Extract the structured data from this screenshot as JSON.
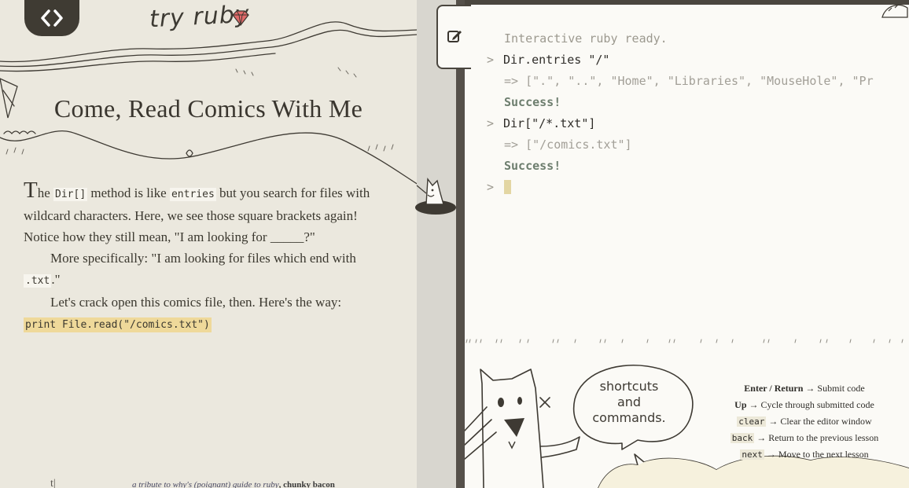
{
  "header": {
    "site_title": "try ruby",
    "logo_icon": "code-brackets-icon"
  },
  "lesson": {
    "title": "Come, Read Comics With Me",
    "p1_dropcap": "T",
    "p1_a": "he ",
    "p1_code1": "Dir[]",
    "p1_b": " method is like ",
    "p1_code2": "entries",
    "p1_c": " but you search for files with wildcard characters. Here, we see those square brackets again! Notice how they still mean, \"I am looking for _____?\"",
    "p2_a": "More specifically: \"I am looking for files which end with ",
    "p2_code": ".txt",
    "p2_b": ".\"",
    "p3": "Let's crack open this comics file, then. Here's the way:",
    "snippet": "print File.read(\"/comics.txt\")"
  },
  "footer": {
    "mark": "t|",
    "tribute_prefix": "a tribute to ",
    "tribute_link": "why's (poignant) guide to ruby",
    "tribute_suffix": ", chunky bacon"
  },
  "console": {
    "ready": "Interactive ruby ready.",
    "prompt_symbol": ">",
    "lines": [
      {
        "input": "Dir.entries \"/\"",
        "result": "=> [\".\", \"..\", \"Home\", \"Libraries\", \"MouseHole\", \"Pr",
        "status": "Success!"
      },
      {
        "input": "Dir[\"/*.txt\"]",
        "result": "=> [\"/comics.txt\"]",
        "status": "Success!"
      }
    ]
  },
  "illustration": {
    "speech_bubble": [
      "shortcuts",
      "and",
      "commands."
    ]
  },
  "shortcuts": [
    {
      "key": "Enter / Return",
      "desc": "→ Submit code"
    },
    {
      "key": "Up",
      "desc": "→ Cycle through submitted code"
    },
    {
      "key": "clear",
      "desc": "→ Clear the editor window"
    },
    {
      "key": "back",
      "desc": "→ Return to the previous lesson"
    },
    {
      "key": "next",
      "desc": "→ Move to the next lesson"
    }
  ],
  "colors": {
    "dark": "#3f3b33",
    "highlight": "#efd99a",
    "success": "#6d7e6e",
    "ruby": "#e06a6a"
  }
}
